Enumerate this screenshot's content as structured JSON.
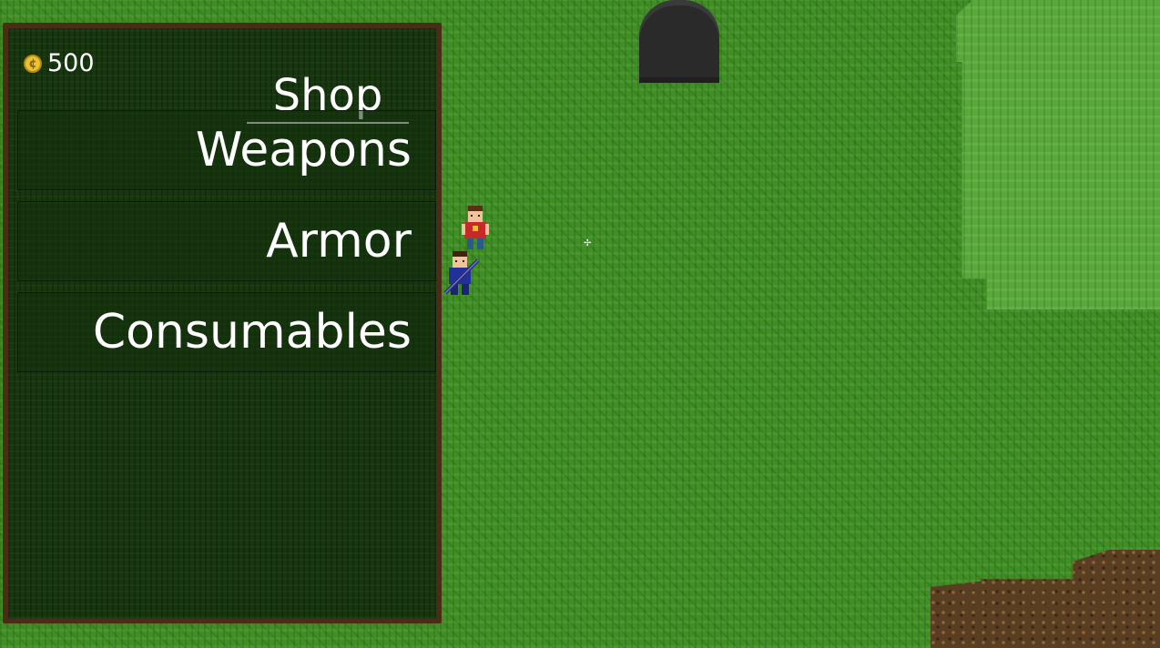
{
  "hud": {
    "currency_icon": "coin-icon",
    "currency_symbol": "¢",
    "currency_amount": "500"
  },
  "shop": {
    "title": "Shop",
    "categories": [
      {
        "label": "Weapons"
      },
      {
        "label": "Armor"
      },
      {
        "label": "Consumables"
      }
    ]
  },
  "colors": {
    "grass": "#3f8f24",
    "panel_bg": "#16360e",
    "panel_border": "#4b2c17",
    "coin": "#e7c232",
    "text": "#ffffff"
  }
}
